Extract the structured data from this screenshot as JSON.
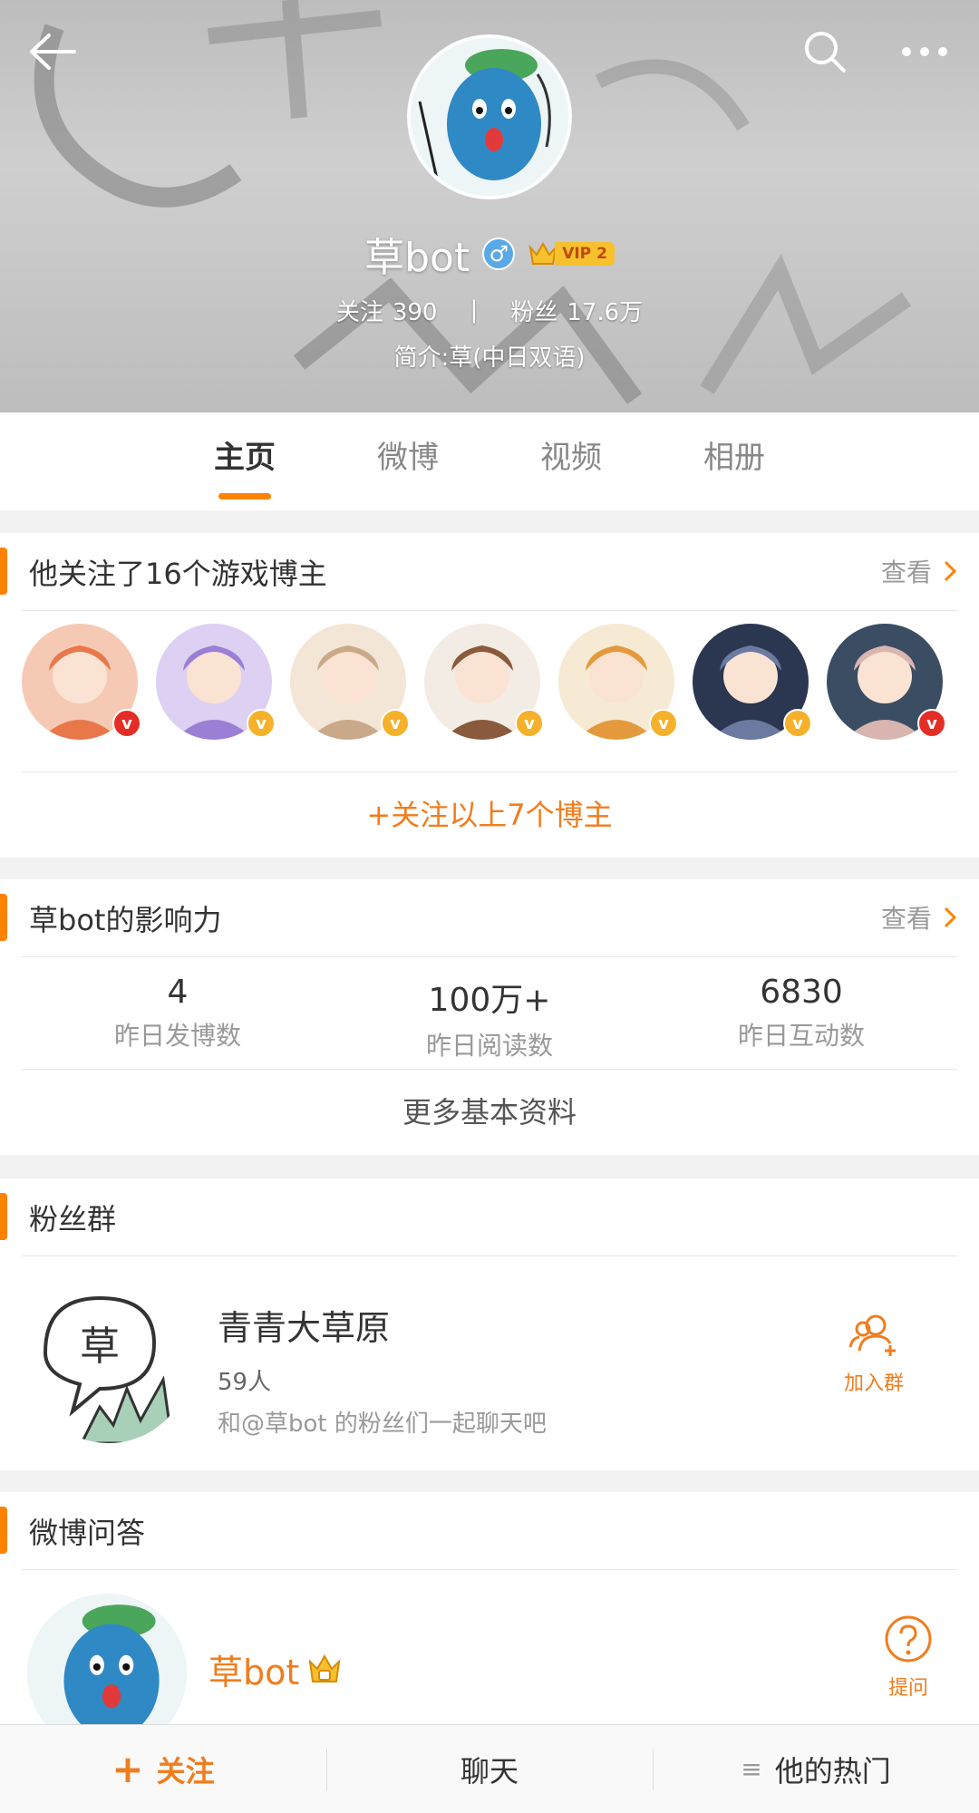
{
  "header": {
    "user_name": "草bot",
    "gender_symbol": "♂",
    "vip_label": "VIP 2",
    "following_label": "关注",
    "following_count": "390",
    "separator": "|",
    "fans_label": "粉丝",
    "fans_count": "17.6万",
    "bio": "简介:草(中日双语)",
    "icons": {
      "back": "back-arrow-icon",
      "search": "search-icon",
      "more": "more-dots-icon"
    }
  },
  "tabs": [
    {
      "label": "主页",
      "active": true
    },
    {
      "label": "微博",
      "active": false
    },
    {
      "label": "视频",
      "active": false
    },
    {
      "label": "相册",
      "active": false
    }
  ],
  "following_card": {
    "title": "他关注了16个游戏博主",
    "view_label": "查看",
    "avatars": [
      {
        "badge": "v",
        "badge_color": "#e52d27"
      },
      {
        "badge": "v",
        "badge_color": "#f5b12a"
      },
      {
        "badge": "v",
        "badge_color": "#f5b12a"
      },
      {
        "badge": "v",
        "badge_color": "#f5b12a"
      },
      {
        "badge": "v",
        "badge_color": "#f5b12a"
      },
      {
        "badge": "v",
        "badge_color": "#f5b12a"
      },
      {
        "badge": "v",
        "badge_color": "#e52d27"
      }
    ],
    "follow_all_label": "+关注以上7个博主"
  },
  "influence_card": {
    "title": "草bot的影响力",
    "view_label": "查看",
    "stats": [
      {
        "value": "4",
        "label": "昨日发博数"
      },
      {
        "value": "100万+",
        "label": "昨日阅读数"
      },
      {
        "value": "6830",
        "label": "昨日互动数"
      }
    ],
    "more_label": "更多基本资料"
  },
  "fan_group_card": {
    "title": "粉丝群",
    "avatar_text": "草",
    "group_name": "青青大草原",
    "member_count": "59人",
    "description": "和@草bot 的粉丝们一起聊天吧",
    "join_label": "加入群"
  },
  "qa_card": {
    "title": "微博问答",
    "user_name": "草bot",
    "ask_label": "提问"
  },
  "bottom_bar": {
    "follow_icon": "+",
    "follow_label": "关注",
    "chat_label": "聊天",
    "hot_icon": "≡",
    "hot_label": "他的热门"
  },
  "colors": {
    "accent": "#ff8200",
    "link_orange": "#f07d1e",
    "verified_red": "#e52d27",
    "verified_gold": "#f5b12a"
  }
}
